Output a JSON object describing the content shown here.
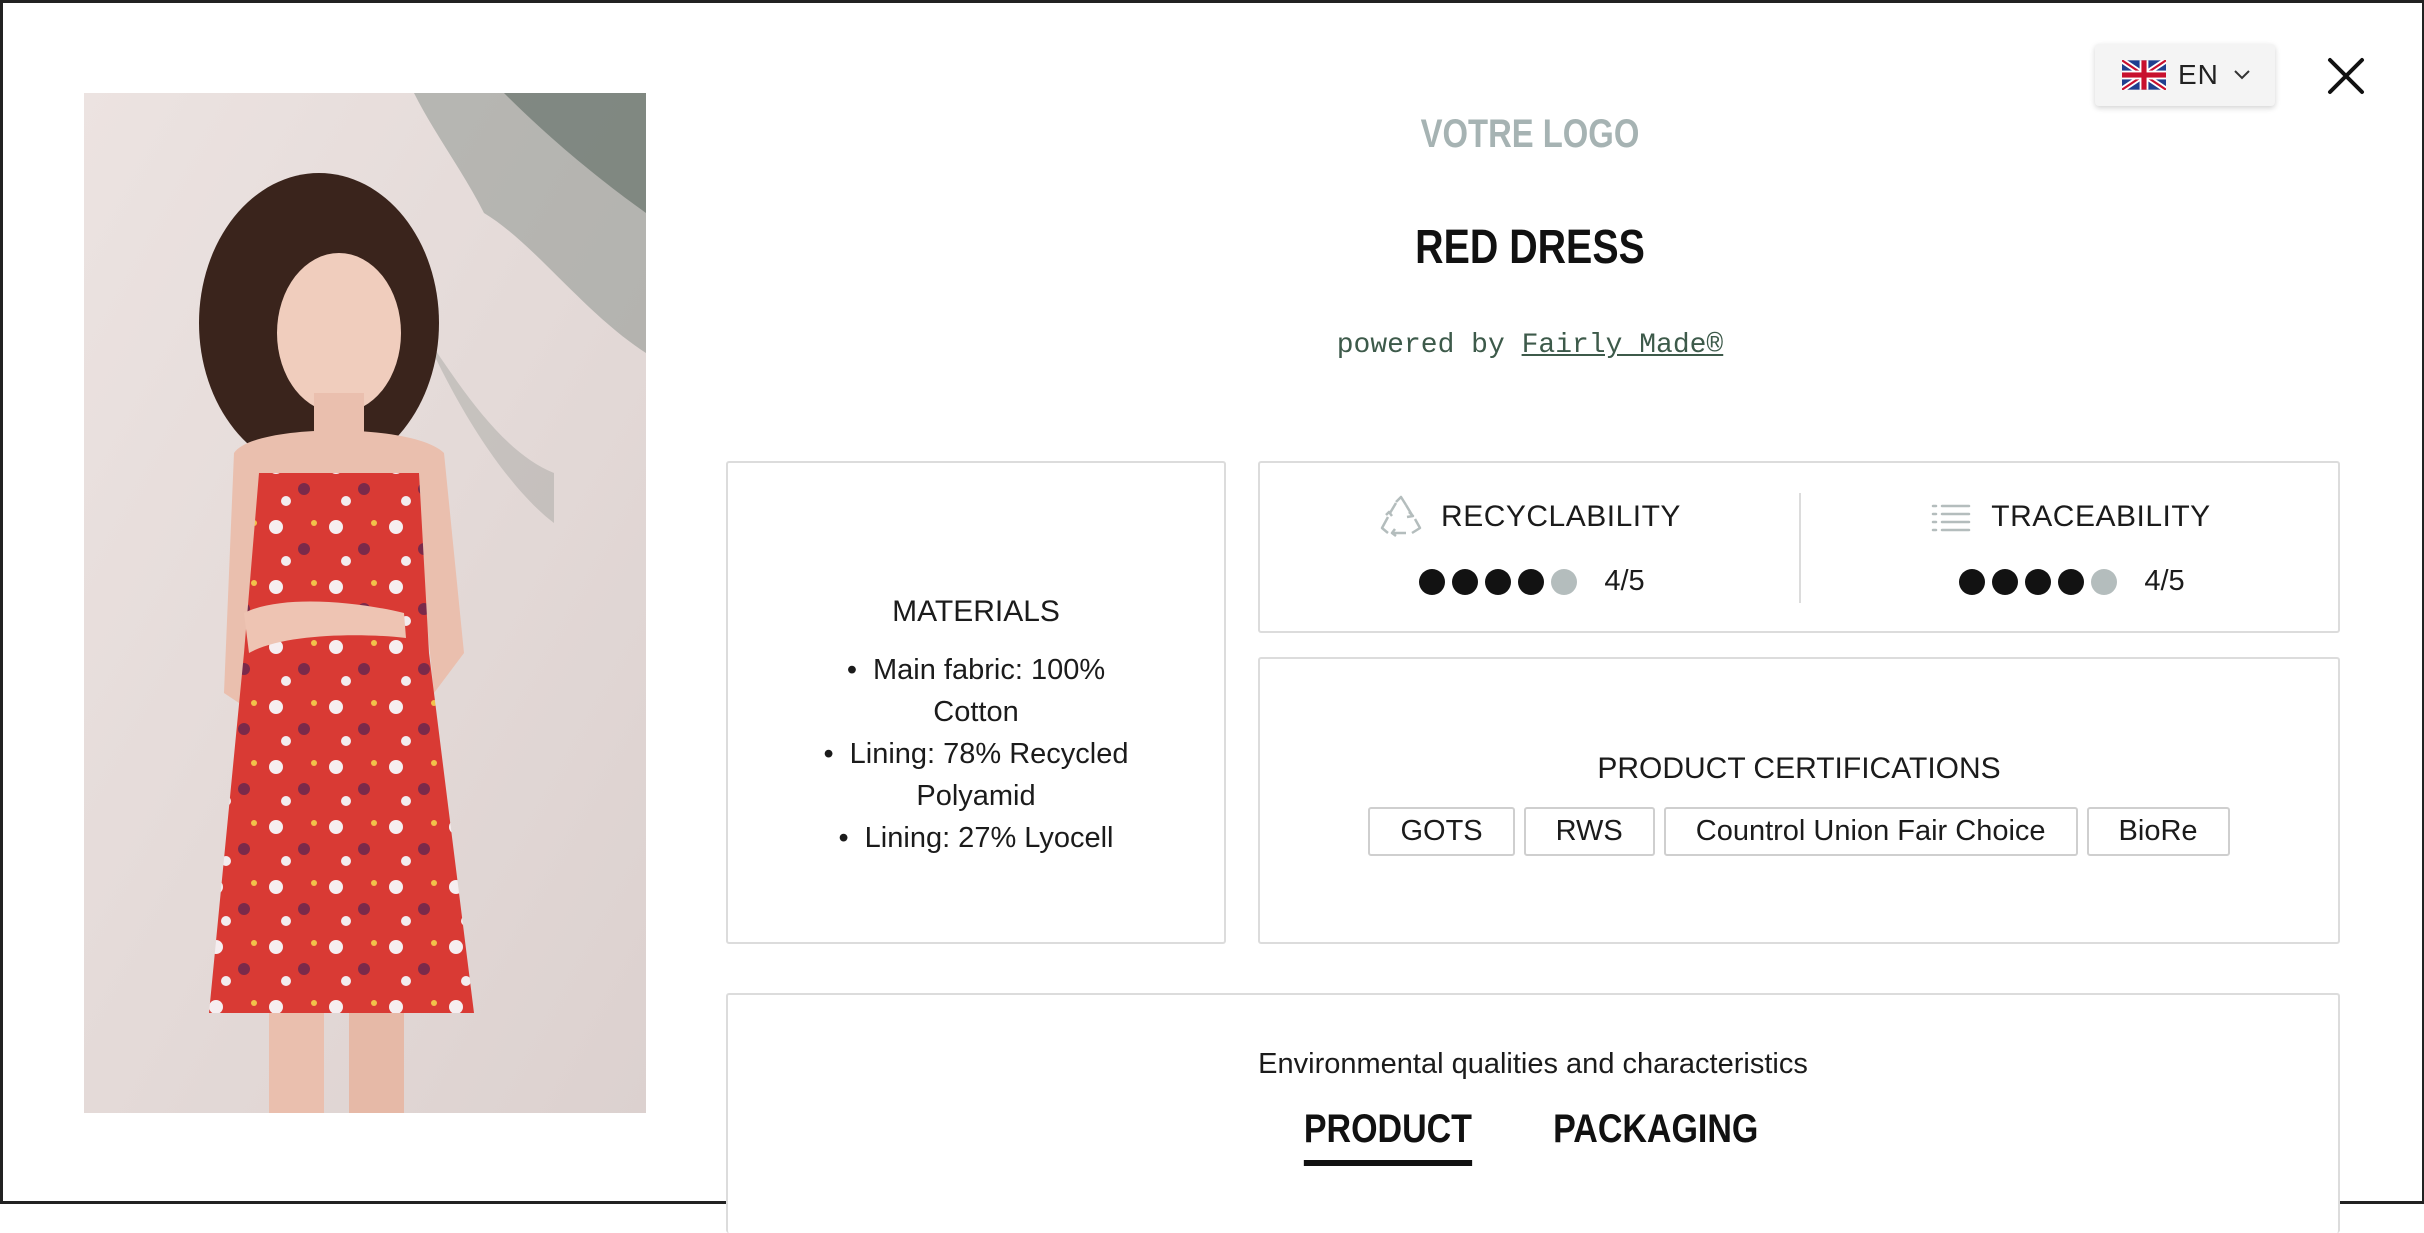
{
  "brand": {
    "logo_text": "VOTRE LOGO"
  },
  "product": {
    "title": "RED DRESS"
  },
  "powered": {
    "prefix": "powered by ",
    "link": "Fairly Made®"
  },
  "language": {
    "code": "EN",
    "flag_icon": "uk-flag-icon"
  },
  "materials": {
    "heading": "MATERIALS",
    "items": [
      "Main fabric: 100% Cotton",
      "Lining: 78% Recycled Polyamid",
      "Lining: 27% Lyocell"
    ]
  },
  "recyclability": {
    "label": "RECYCLABILITY",
    "icon": "recycle-icon",
    "rating": 4,
    "max": 5,
    "value_text": "4/5"
  },
  "traceability": {
    "label": "TRACEABILITY",
    "icon": "list-icon",
    "rating": 4,
    "max": 5,
    "value_text": "4/5"
  },
  "certifications": {
    "heading": "PRODUCT CERTIFICATIONS",
    "items": [
      "GOTS",
      "RWS",
      "Countrol Union Fair Choice",
      "BioRe"
    ]
  },
  "environment": {
    "heading": "Environmental qualities and characteristics",
    "tabs": [
      "PRODUCT",
      "PACKAGING"
    ],
    "active_tab": "PRODUCT"
  },
  "colors": {
    "accent_dark": "#121212",
    "muted_logo": "#a6b3b3",
    "dot_empty": "#b4bdbd",
    "powered_text": "#3d5a4a"
  }
}
